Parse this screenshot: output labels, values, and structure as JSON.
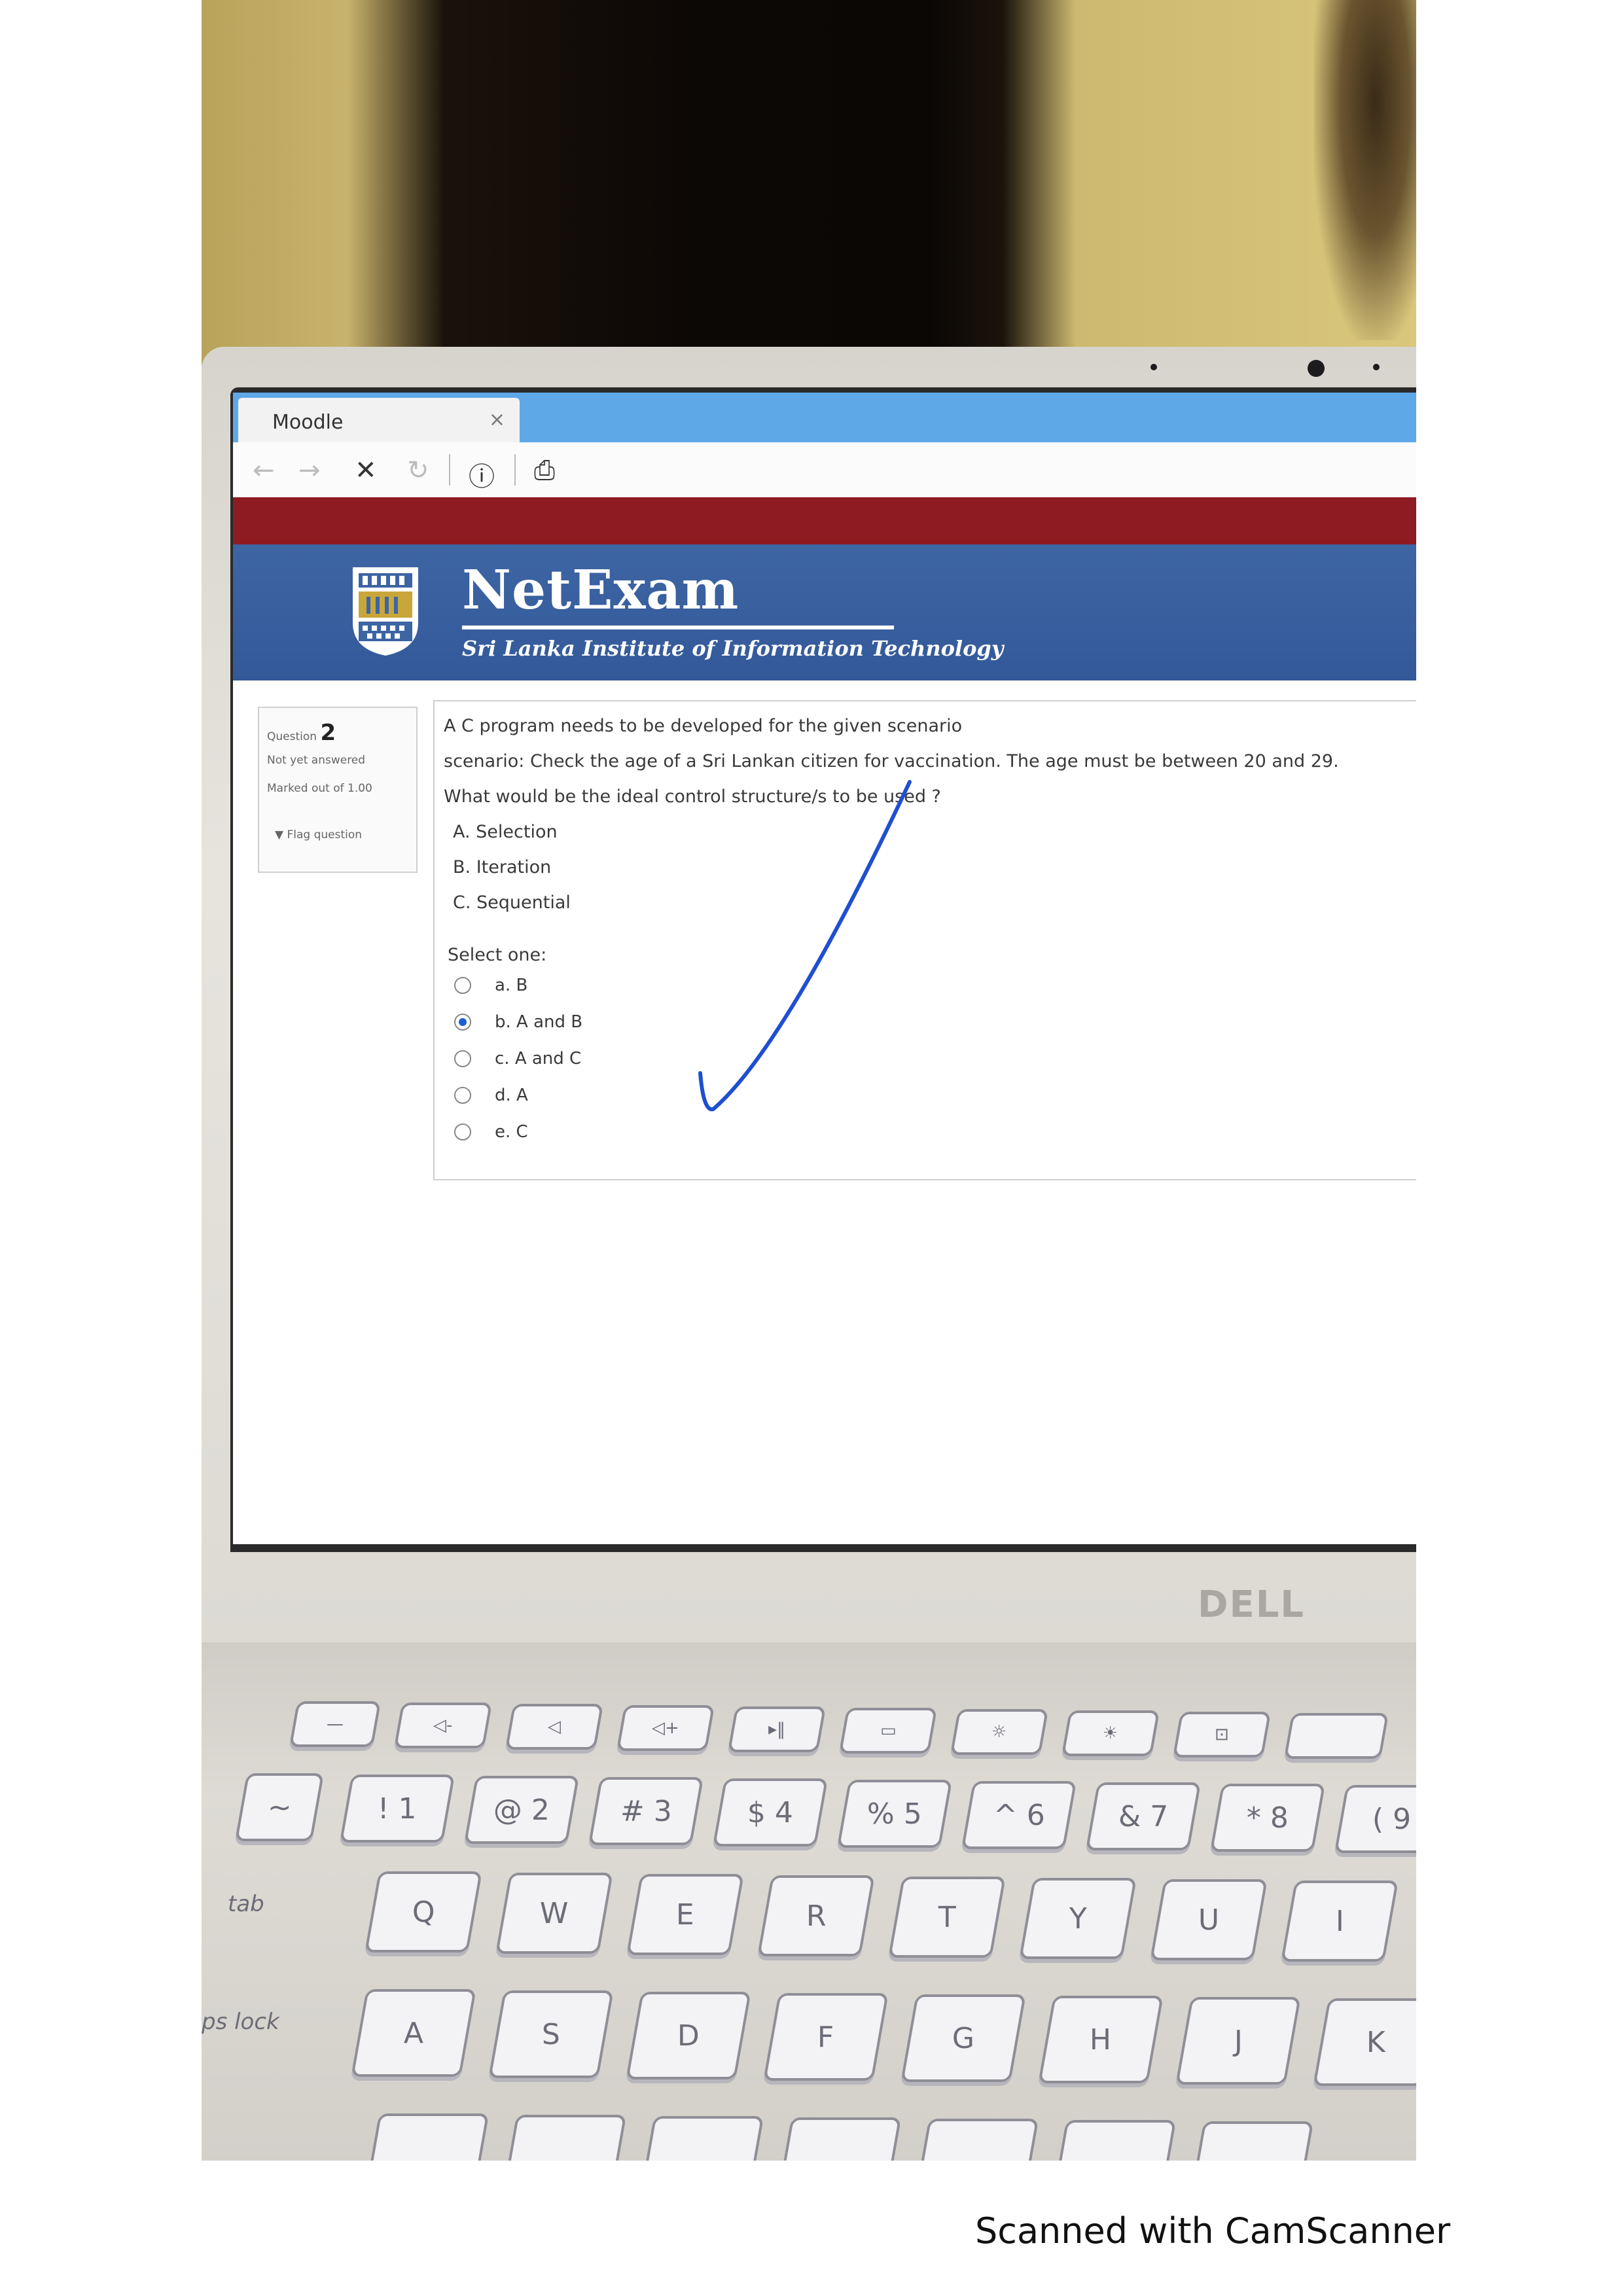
{
  "browser": {
    "tab_title": "Moodle",
    "tab_close": "×",
    "nav": {
      "back": "←",
      "forward": "→",
      "stop": "✕",
      "reload": "↻",
      "info": "ⓘ",
      "page": "⎙"
    }
  },
  "brand": {
    "title": "NetExam",
    "subtitle": "Sri Lanka Institute of Information Technology",
    "colors": {
      "banner": "#3e65a3",
      "redbar": "#8e1b22",
      "tabbar": "#5ea8e8"
    }
  },
  "question_info": {
    "label": "Question",
    "number": "2",
    "state": "Not yet answered",
    "marks": "Marked out of 1.00",
    "flag": "Flag question"
  },
  "question": {
    "line1": "A C program needs to be developed for the given scenario",
    "line2": "scenario: Check the age of a Sri Lankan citizen for vaccination. The age must be between 20 and 29.",
    "line3": "What would be the ideal control structure/s to be used ?",
    "options_text": [
      "A. Selection",
      "B. Iteration",
      "C. Sequential"
    ],
    "select_prompt": "Select one:",
    "answers": [
      {
        "label": "a. B",
        "selected": false
      },
      {
        "label": "b. A and B",
        "selected": true
      },
      {
        "label": "c. A and C",
        "selected": false
      },
      {
        "label": "d. A",
        "selected": false
      },
      {
        "label": "e. C",
        "selected": false
      }
    ]
  },
  "laptop": {
    "brand": "DELL"
  },
  "keyboard": {
    "row_numbers": [
      "!\n1",
      "@\n2",
      "#\n3",
      "$\n4",
      "%\n5",
      "^\n6",
      "&\n7",
      "*\n8",
      "(\n9"
    ],
    "row_q": [
      "Q",
      "W",
      "E",
      "R",
      "T",
      "Y",
      "U",
      "I"
    ],
    "row_a": [
      "A",
      "S",
      "D",
      "F",
      "G",
      "H",
      "J",
      "K"
    ],
    "tab_label": "tab",
    "caps_label": "ps lock"
  },
  "footer": {
    "text": "Scanned with CamScanner"
  }
}
